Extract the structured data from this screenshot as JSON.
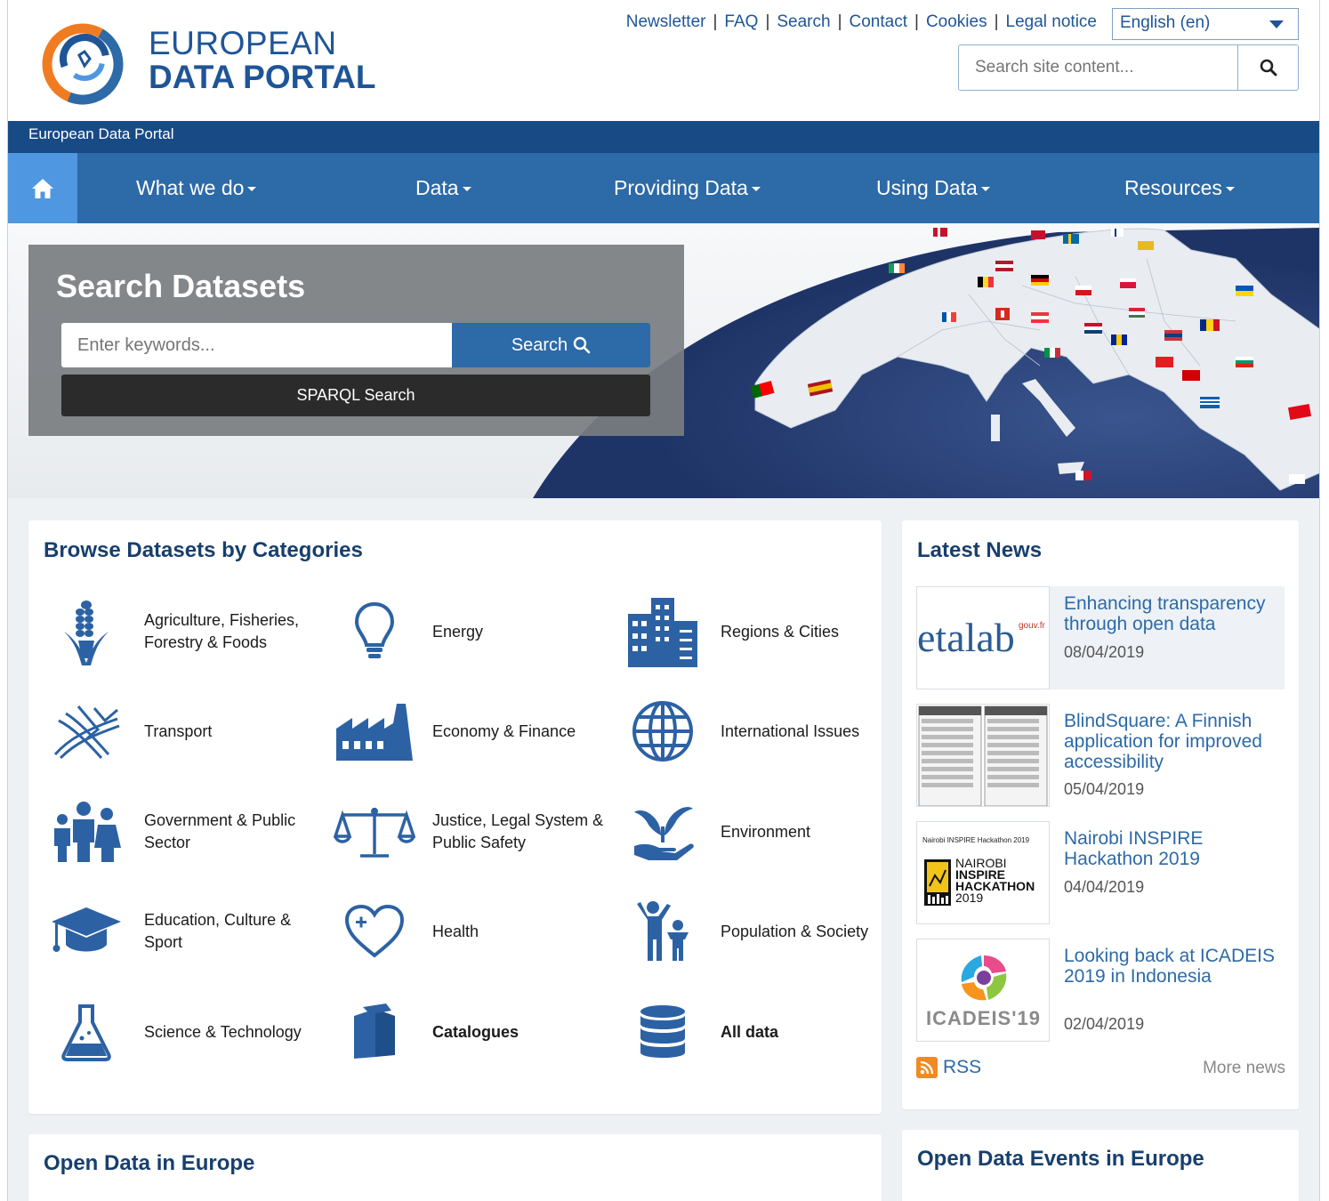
{
  "header": {
    "logo_line1": "EUROPEAN",
    "logo_line2": "DATA PORTAL",
    "top_links": [
      "Newsletter",
      "FAQ",
      "Search",
      "Contact",
      "Cookies",
      "Legal notice"
    ],
    "language": "English (en)",
    "site_search_placeholder": "Search site content..."
  },
  "breadcrumb": "European Data Portal",
  "nav": {
    "items": [
      "What we do",
      "Data",
      "Providing Data",
      "Using Data",
      "Resources"
    ]
  },
  "hero": {
    "title": "Search Datasets",
    "keyword_placeholder": "Enter keywords...",
    "search_button": "Search",
    "sparql_button": "SPARQL Search"
  },
  "categories": {
    "title": "Browse Datasets by Categories",
    "items": [
      {
        "label": "Agriculture, Fisheries, Forestry & Foods",
        "icon": "corn-icon"
      },
      {
        "label": "Energy",
        "icon": "lightbulb-icon"
      },
      {
        "label": "Regions & Cities",
        "icon": "buildings-icon"
      },
      {
        "label": "Transport",
        "icon": "roads-icon"
      },
      {
        "label": "Economy & Finance",
        "icon": "factory-icon"
      },
      {
        "label": "International Issues",
        "icon": "globe-icon"
      },
      {
        "label": "Government & Public Sector",
        "icon": "people-icon"
      },
      {
        "label": "Justice, Legal System & Public Safety",
        "icon": "scales-icon"
      },
      {
        "label": "Environment",
        "icon": "plant-hand-icon"
      },
      {
        "label": "Education, Culture & Sport",
        "icon": "graduation-cap-icon"
      },
      {
        "label": "Health",
        "icon": "heart-icon"
      },
      {
        "label": "Population & Society",
        "icon": "family-icon"
      },
      {
        "label": "Science & Technology",
        "icon": "flask-icon"
      },
      {
        "label": "Catalogues",
        "icon": "books-icon"
      },
      {
        "label": "All data",
        "icon": "database-icon"
      }
    ]
  },
  "news": {
    "title": "Latest News",
    "items": [
      {
        "title": "Enhancing transparency through open data",
        "date": "08/04/2019",
        "thumb_text": "etalab",
        "thumb_sup": "gouv.fr"
      },
      {
        "title": "BlindSquare: A Finnish application for improved accessibility",
        "date": "05/04/2019"
      },
      {
        "title": "Nairobi INSPIRE Hackathon 2019",
        "date": "04/04/2019",
        "thumb_caption": "Nairobi INSPIRE Hackathon 2019",
        "thumb_line1": "NAIROBI",
        "thumb_line2": "INSPIRE",
        "thumb_line3": "HACKATHON",
        "thumb_line4": "2019"
      },
      {
        "title": "Looking back at ICADEIS 2019 in Indonesia",
        "date": "02/04/2019",
        "thumb_text": "ICADEIS'19"
      }
    ],
    "rss": "RSS",
    "more": "More news"
  },
  "europe_title": "Open Data in Europe",
  "events_title": "Open Data Events in Europe",
  "colors": {
    "brand_blue": "#1f5597",
    "nav_blue": "#2c6aa8",
    "dark_blue": "#184a86",
    "icon_blue": "#2c62a3",
    "heading": "#173f6e"
  }
}
